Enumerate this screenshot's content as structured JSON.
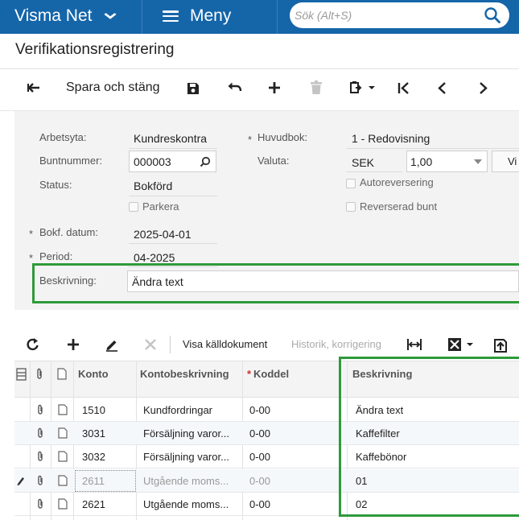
{
  "topbar": {
    "brand": "Visma Net",
    "menu_label": "Meny",
    "search_placeholder": "Sök (Alt+S)"
  },
  "page": {
    "title": "Verifikationsregistrering"
  },
  "toolbar": {
    "save_close_label": "Spara och stäng"
  },
  "form": {
    "arbetsyta_label": "Arbetsyta:",
    "arbetsyta_value": "Kundreskontra",
    "buntnummer_label": "Buntnummer:",
    "buntnummer_value": "000003",
    "status_label": "Status:",
    "status_value": "Bokförd",
    "parkera_label": "Parkera",
    "bokf_datum_label": "Bokf. datum:",
    "bokf_datum_value": "2025-04-01",
    "period_label": "Period:",
    "period_value": "04-2025",
    "beskrivning_label": "Beskrivning:",
    "beskrivning_value": "Ändra text",
    "huvudbok_label": "Huvudbok:",
    "huvudbok_value": "1 - Redovisning",
    "valuta_label": "Valuta:",
    "valuta_value": "SEK",
    "kurs_value": "1,00",
    "visa_label": "Vi",
    "autoreversering_label": "Autoreversering",
    "reverserad_bunt_label": "Reverserad bunt",
    "required_mark": "*"
  },
  "grid_toolbar": {
    "visa_kalldokument": "Visa källdokument",
    "historik_korrigering": "Historik, korrigering"
  },
  "grid": {
    "headers": {
      "konto": "Konto",
      "kontobeskrivning": "Kontobeskrivning",
      "koddel": "Koddel",
      "koddel_required": "*",
      "beskrivning": "Beskrivning"
    },
    "rows": [
      {
        "konto": "1510",
        "kontobeskrivning": "Kundfordringar",
        "koddel": "0-00",
        "beskrivning": "Ändra text"
      },
      {
        "konto": "3031",
        "kontobeskrivning": "Försäljning varor...",
        "koddel": "0-00",
        "beskrivning": "Kaffefilter"
      },
      {
        "konto": "3032",
        "kontobeskrivning": "Försäljning varor...",
        "koddel": "0-00",
        "beskrivning": "Kaffebönor"
      },
      {
        "konto": "2611",
        "kontobeskrivning": "Utgående moms...",
        "koddel": "0-00",
        "beskrivning": "01"
      },
      {
        "konto": "2621",
        "kontobeskrivning": "Utgående moms...",
        "koddel": "0-00",
        "beskrivning": "02"
      }
    ]
  },
  "colors": {
    "topbar": "#1565a9",
    "highlight_border": "#2e9a3a",
    "required": "#d32f2f"
  }
}
